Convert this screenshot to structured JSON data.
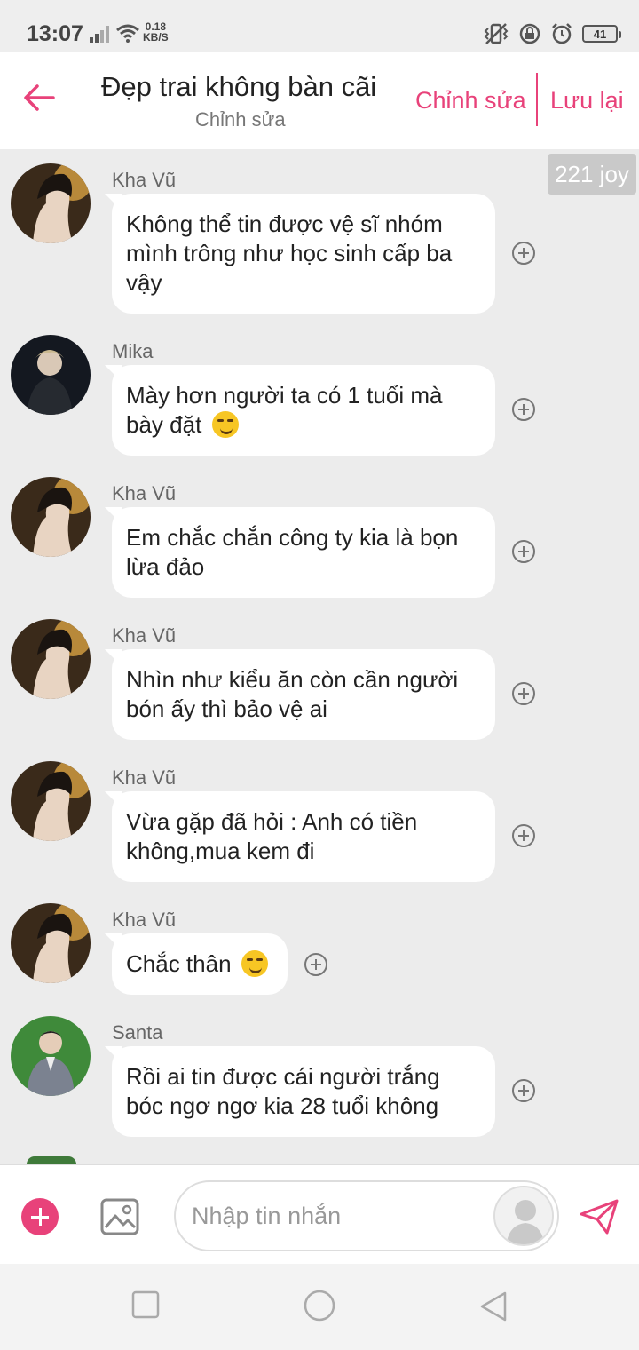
{
  "status_bar": {
    "time": "13:07",
    "net_speed_value": "0.18",
    "net_speed_unit": "KB/S",
    "battery": "41",
    "icons": [
      "signal-icon",
      "wifi-icon",
      "vibrate-icon",
      "rotation-lock-icon",
      "alarm-icon",
      "battery-icon"
    ]
  },
  "header": {
    "title": "Đẹp trai không bàn cãi",
    "subtitle": "Chỉnh sửa",
    "edit_label": "Chỉnh sửa",
    "save_label": "Lưu lại",
    "accent_color": "#e8427a"
  },
  "joy_badge": "221 joy",
  "messages": [
    {
      "sender": "Kha Vũ",
      "lines": [
        "Không thể tin được vệ sĩ nhóm",
        "mình trông như học sinh cấp ba",
        "vậy"
      ],
      "emoji": false
    },
    {
      "sender": "Mika",
      "lines": [
        "Mày hơn người ta có 1 tuổi mà",
        "bày đặt"
      ],
      "emoji": true
    },
    {
      "sender": "Kha Vũ",
      "lines": [
        "Em chắc chắn công ty kia là bọn",
        "lừa đảo"
      ],
      "emoji": false
    },
    {
      "sender": "Kha Vũ",
      "lines": [
        "Nhìn như kiểu ăn còn cần người",
        "bón ấy thì bảo vệ ai"
      ],
      "emoji": false
    },
    {
      "sender": "Kha Vũ",
      "lines": [
        "Vừa gặp đã hỏi : Anh có tiền",
        "không,mua kem đi"
      ],
      "emoji": false
    },
    {
      "sender": "Kha Vũ",
      "lines": [
        "Chắc thân"
      ],
      "emoji": true
    },
    {
      "sender": "Santa",
      "lines": [
        "Rồi ai tin được cái người trắng",
        "bóc ngơ ngơ kia 28 tuổi không"
      ],
      "emoji": false
    }
  ],
  "composer": {
    "placeholder": "Nhập tin nhắn"
  }
}
